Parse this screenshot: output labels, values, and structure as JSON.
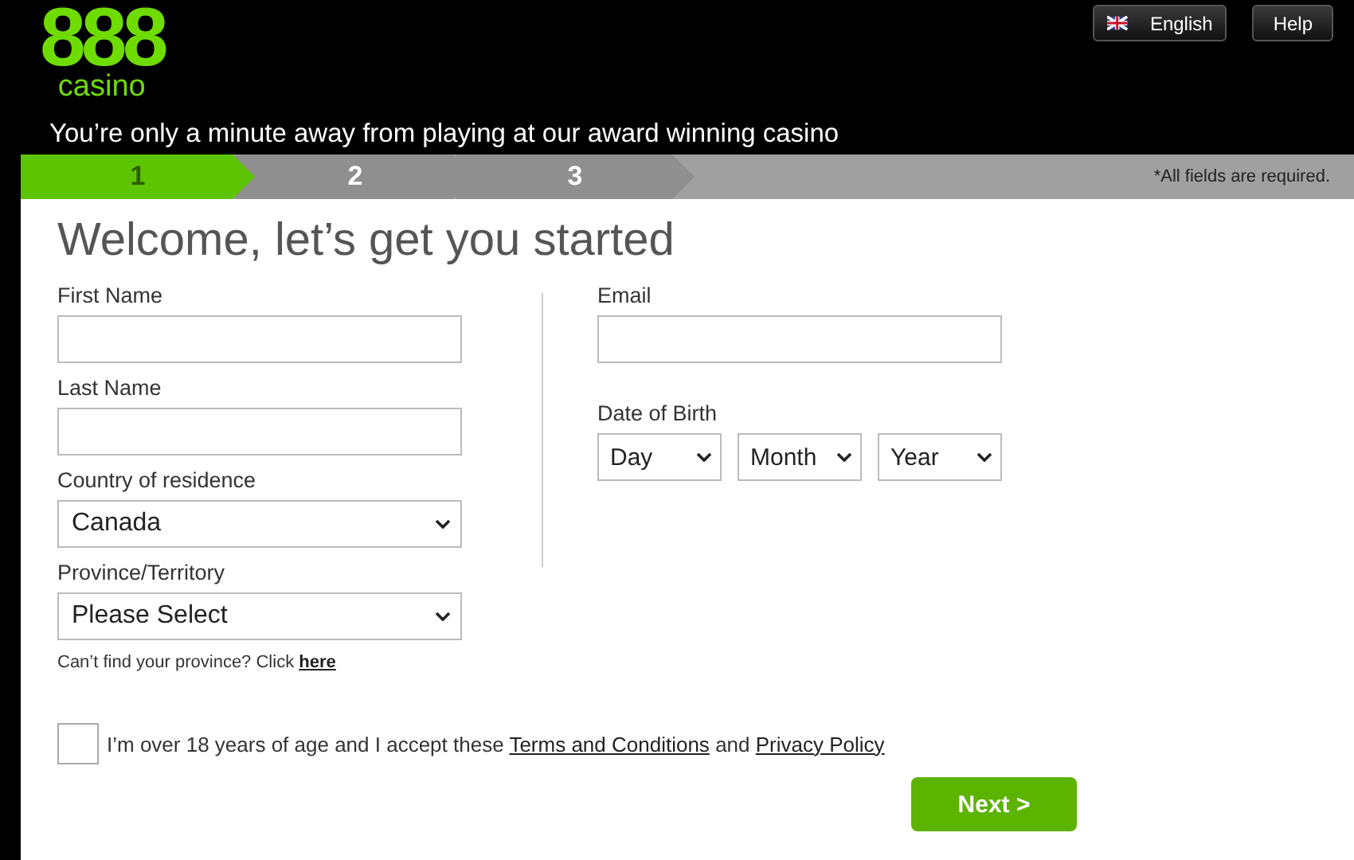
{
  "header": {
    "logo": {
      "number": "888",
      "word": "casino"
    },
    "language_button": "English",
    "help_button": "Help",
    "tagline": "You’re only a minute away from playing at our award winning casino"
  },
  "steps": [
    {
      "label": "1",
      "selected": true
    },
    {
      "label": "2",
      "selected": false
    },
    {
      "label": "3",
      "selected": false
    }
  ],
  "required_note": "*All fields are required.",
  "form": {
    "title": "Welcome, let’s get you started",
    "left_fields": [
      {
        "kind": "text",
        "label": "First Name"
      },
      {
        "kind": "text",
        "label": "Last Name"
      },
      {
        "kind": "select",
        "label": "Country of residence",
        "value": "Canada"
      },
      {
        "kind": "select",
        "label": "Province/Territory",
        "value": "Please Select"
      }
    ],
    "province_help": {
      "text": "Can’t find your province? Click",
      "link": "here"
    },
    "email": {
      "label": "Email"
    },
    "date_of_birth": {
      "label": "Date of Birth",
      "selects": [
        "Day",
        "Month",
        "Year"
      ]
    },
    "agreement": {
      "checked": false,
      "text": "I’m over 18 years of age and I accept these",
      "terms_link": "Terms and Conditions",
      "joiner": "and",
      "privacy_link": "Privacy Policy"
    },
    "next_button": "Next >"
  }
}
